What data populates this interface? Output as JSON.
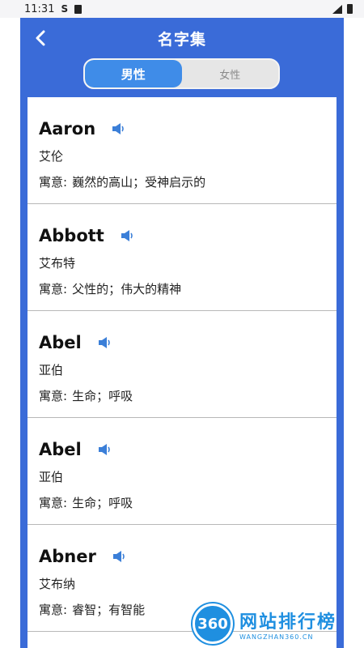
{
  "status_bar": {
    "time": "11:31",
    "s_glyph": "S"
  },
  "header": {
    "title": "名字集"
  },
  "tabs": [
    {
      "label": "男性",
      "active": true
    },
    {
      "label": "女性",
      "active": false
    }
  ],
  "names": [
    {
      "en": "Aaron",
      "cn": "艾伦",
      "meaning_label": "寓意:",
      "meaning": "巍然的高山；受神启示的"
    },
    {
      "en": "Abbott",
      "cn": "艾布特",
      "meaning_label": "寓意:",
      "meaning": "父性的；伟大的精神"
    },
    {
      "en": "Abel",
      "cn": "亚伯",
      "meaning_label": "寓意:",
      "meaning": "生命；呼吸"
    },
    {
      "en": "Abel",
      "cn": "亚伯",
      "meaning_label": "寓意:",
      "meaning": "生命；呼吸"
    },
    {
      "en": "Abner",
      "cn": "艾布纳",
      "meaning_label": "寓意:",
      "meaning": "睿智；有智能"
    }
  ],
  "watermark": {
    "logo_text": "360",
    "cn": "网站排行榜",
    "en": "WANGZHAN360.CN"
  },
  "colors": {
    "frame": "#3a6bd8",
    "tab_active": "#3f8ce8",
    "speaker": "#3b7fd8"
  },
  "icons": [
    "back-arrow-icon",
    "speaker-icon",
    "signal-icon",
    "battery-icon",
    "sim-card-icon"
  ]
}
